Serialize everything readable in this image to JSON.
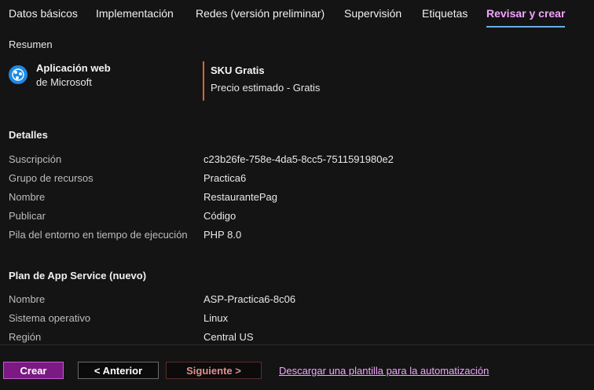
{
  "tabs": [
    {
      "label": "Datos básicos"
    },
    {
      "label": "Implementación"
    },
    {
      "label": "Redes (versión preliminar)"
    },
    {
      "label": "Supervisión"
    },
    {
      "label": "Etiquetas"
    },
    {
      "label": "Revisar y crear"
    }
  ],
  "summary": {
    "heading": "Resumen",
    "product_name": "Aplicación web",
    "publisher": "de Microsoft",
    "sku": "SKU Gratis",
    "price": "Precio estimado - Gratis"
  },
  "details": {
    "heading": "Detalles",
    "rows": [
      {
        "label": "Suscripción",
        "value": "c23b26fe-758e-4da5-8cc5-7511591980e2"
      },
      {
        "label": "Grupo de recursos",
        "value": "Practica6"
      },
      {
        "label": "Nombre",
        "value": "RestaurantePag"
      },
      {
        "label": "Publicar",
        "value": "Código"
      },
      {
        "label": "Pila del entorno en tiempo de ejecución",
        "value": "PHP 8.0"
      }
    ]
  },
  "plan": {
    "heading": "Plan de App Service (nuevo)",
    "rows": [
      {
        "label": "Nombre",
        "value": "ASP-Practica6-8c06"
      },
      {
        "label": "Sistema operativo",
        "value": "Linux"
      },
      {
        "label": "Región",
        "value": "Central US"
      }
    ]
  },
  "footer": {
    "create_label": "Crear",
    "prev_label": "< Anterior",
    "next_label": "Siguiente >",
    "template_link": "Descargar una plantilla para la automatización"
  },
  "colors": {
    "active_tab": "#f3a3ff",
    "tab_underline": "#6aaee8",
    "sku_accent": "#d4692a",
    "create_button": "#7a1a82"
  }
}
